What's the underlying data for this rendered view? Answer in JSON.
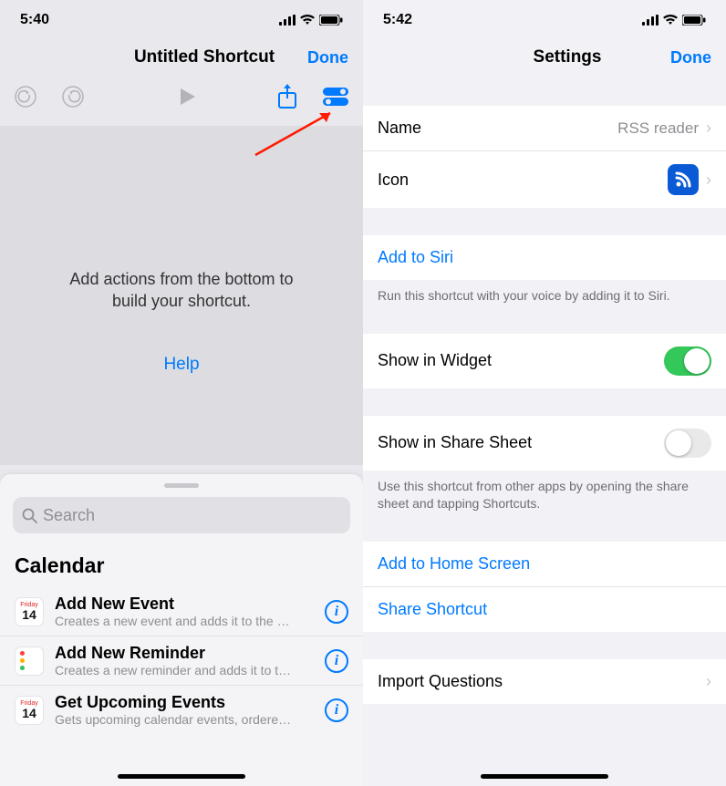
{
  "left": {
    "status_time": "5:40",
    "nav_title": "Untitled Shortcut",
    "nav_done": "Done",
    "editor_hint_line1": "Add actions from the bottom to",
    "editor_hint_line2": "build your shortcut.",
    "help": "Help",
    "search_placeholder": "Search",
    "section": "Calendar",
    "actions": [
      {
        "title": "Add New Event",
        "sub": "Creates a new event and adds it to the sel…",
        "icon_weekday": "Friday",
        "icon_day": "14"
      },
      {
        "title": "Add New Reminder",
        "sub": "Creates a new reminder and adds it to the…"
      },
      {
        "title": "Get Upcoming Events",
        "sub": "Gets upcoming calendar events, ordered fr…",
        "icon_weekday": "Friday",
        "icon_day": "14"
      }
    ]
  },
  "right": {
    "status_time": "5:42",
    "nav_title": "Settings",
    "nav_done": "Done",
    "name_label": "Name",
    "name_value": "RSS reader",
    "icon_label": "Icon",
    "add_to_siri": "Add to Siri",
    "siri_note": "Run this shortcut with your voice by adding it to Siri.",
    "show_widget": "Show in Widget",
    "show_widget_on": true,
    "show_share": "Show in Share Sheet",
    "show_share_on": false,
    "share_note": "Use this shortcut from other apps by opening the share sheet and tapping Shortcuts.",
    "add_home": "Add to Home Screen",
    "share_shortcut": "Share Shortcut",
    "import_questions": "Import Questions"
  }
}
